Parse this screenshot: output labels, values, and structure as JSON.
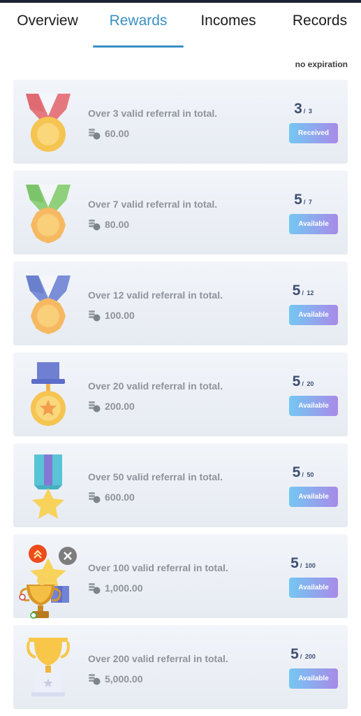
{
  "tabs": [
    {
      "label": "Overview"
    },
    {
      "label": "Rewards"
    },
    {
      "label": "Incomes"
    },
    {
      "label": "Records"
    }
  ],
  "active_tab": "Rewards",
  "note": "no expiration",
  "colors": {
    "accent": "#3a8fc4",
    "text_muted": "#8e939b",
    "progress_text": "#3f4f73",
    "button_gradient_start": "#74c7f2",
    "button_gradient_end": "#a88ae8"
  },
  "rewards": [
    {
      "title": "Over 3 valid referral in total.",
      "amount": "60.00",
      "current": "3",
      "separator": "/",
      "total": "3",
      "status": "Received",
      "icon": "red-ribbon-medal-icon"
    },
    {
      "title": "Over 7 valid referral in total.",
      "amount": "80.00",
      "current": "5",
      "separator": "/",
      "total": "7",
      "status": "Available",
      "icon": "green-ribbon-medal-icon"
    },
    {
      "title": "Over 12 valid referral in total.",
      "amount": "100.00",
      "current": "5",
      "separator": "/",
      "total": "12",
      "status": "Available",
      "icon": "blue-ribbon-medal-icon"
    },
    {
      "title": "Over 20 valid referral in total.",
      "amount": "200.00",
      "current": "5",
      "separator": "/",
      "total": "20",
      "status": "Available",
      "icon": "star-medal-icon"
    },
    {
      "title": "Over 50 valid referral in total.",
      "amount": "600.00",
      "current": "5",
      "separator": "/",
      "total": "50",
      "status": "Available",
      "icon": "star-ribbon-icon"
    },
    {
      "title": "Over 100 valid referral in total.",
      "amount": "1,000.00",
      "current": "5",
      "separator": "/",
      "total": "100",
      "status": "Available",
      "icon": "gift-box-icon"
    },
    {
      "title": "Over 200 valid referral in total.",
      "amount": "5,000.00",
      "current": "5",
      "separator": "/",
      "total": "200",
      "status": "Available",
      "icon": "trophy-icon"
    }
  ],
  "floating_widget": {
    "icon": "trophy-icon",
    "expand_icon": "double-chevron-up-icon",
    "close_icon": "close-icon"
  }
}
